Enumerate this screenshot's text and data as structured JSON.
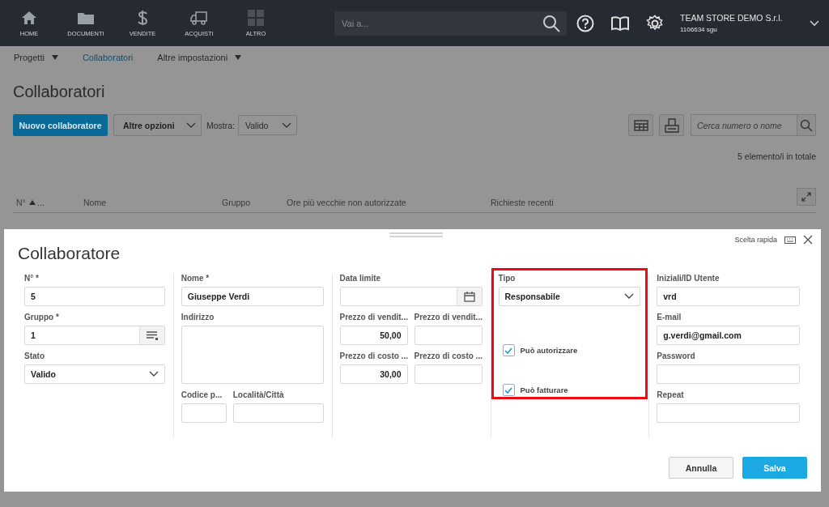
{
  "nav": [
    {
      "label": "HOME",
      "kind": "home"
    },
    {
      "label": "DOCUMENTI",
      "kind": "folder"
    },
    {
      "label": "VENDITE",
      "kind": "dollar"
    },
    {
      "label": "ACQUISTI",
      "kind": "truck"
    },
    {
      "label": "ALTRO",
      "kind": "grid"
    }
  ],
  "search": {
    "placeholder": "Vai a..."
  },
  "company": {
    "name": "TEAM STORE DEMO S.r.l.",
    "id": "1106634 sgu"
  },
  "subnav": [
    {
      "label": "Progetti",
      "dropdown": true,
      "selected": false
    },
    {
      "label": "Collaboratori",
      "dropdown": false,
      "selected": true
    },
    {
      "label": "Altre impostazioni",
      "dropdown": true,
      "selected": false
    }
  ],
  "page_title": "Collaboratori",
  "toolbar": {
    "new_button": "Nuovo collaboratore",
    "options_button": "Altre opzioni",
    "show_label": "Mostra:",
    "show_value": "Valido",
    "search_placeholder": "Cerca numero o nome"
  },
  "total": "5 elemento/i in totale",
  "table_columns": [
    {
      "label": "N°",
      "sorted": true
    },
    {
      "label": "...",
      "sorted": false
    },
    {
      "label": "Nome",
      "sorted": false
    },
    {
      "label": "Gruppo",
      "sorted": false
    },
    {
      "label": "Ore più vecchie non autorizzate",
      "sorted": false
    },
    {
      "label": "Richieste recenti",
      "sorted": false
    }
  ],
  "modal": {
    "title": "Collaboratore",
    "quick_choice": "Scelta rapida",
    "columns": [
      {
        "fields": [
          {
            "kind": "text",
            "label": "N° *",
            "value": "5"
          },
          {
            "kind": "lookup",
            "label": "Gruppo *",
            "value": "1"
          },
          {
            "kind": "select",
            "label": "Stato",
            "value": "Valido"
          }
        ]
      },
      {
        "fields": [
          {
            "kind": "text",
            "label": "Nome *",
            "value": "Giuseppe Verdi"
          },
          {
            "kind": "textarea",
            "label": "Indirizzo"
          },
          {
            "kind": "pair",
            "fields": [
              {
                "label": "Codice p..."
              },
              {
                "label": "Località/Città"
              }
            ]
          }
        ]
      },
      {
        "fields": [
          {
            "kind": "date",
            "label": "Data limite"
          },
          {
            "kind": "pair",
            "fields": [
              {
                "label": "Prezzo di vendit...",
                "value": "50,00"
              },
              {
                "label": "Prezzo di vendit..."
              }
            ]
          },
          {
            "kind": "pair",
            "fields": [
              {
                "label": "Prezzo di costo ...",
                "value": "30,00"
              },
              {
                "label": "Prezzo di costo ..."
              }
            ]
          }
        ]
      },
      {
        "fields": [
          {
            "kind": "frame",
            "fields": [
              {
                "kind": "select",
                "label": "Tipo",
                "value": "Responsabile"
              },
              {
                "kind": "checkbox",
                "label": "Può autorizzare",
                "checked": true
              },
              {
                "kind": "checkbox",
                "label": "Può fatturare",
                "checked": true
              }
            ]
          }
        ]
      },
      {
        "fields": [
          {
            "kind": "text",
            "label": "Iniziali/ID Utente",
            "value": "vrd"
          },
          {
            "kind": "text",
            "label": "E-mail",
            "value": "g.verdi@gmail.com"
          },
          {
            "kind": "text",
            "label": "Password"
          },
          {
            "kind": "text",
            "label": "Repeat"
          }
        ]
      }
    ],
    "buttons": [
      {
        "label": "Annulla",
        "kind": "secondary"
      },
      {
        "label": "Salva",
        "kind": "primary"
      }
    ]
  }
}
